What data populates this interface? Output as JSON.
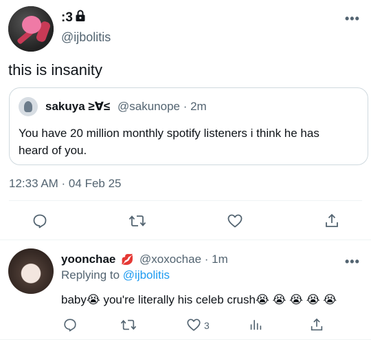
{
  "main_tweet": {
    "display_name": ":3",
    "lock_icon": "lock-icon",
    "handle": "@ijbolitis",
    "more_label": "•••",
    "text": "this is insanity",
    "timestamp": "12:33 AM · 04 Feb 25"
  },
  "quoted_tweet": {
    "display_name": "sakuya ≥∀≤",
    "meta": "@sakunope · 2m",
    "text": "You have 20 million monthly spotify listeners i think he has heard of you."
  },
  "actions": [
    "reply-icon",
    "retweet-icon",
    "like-icon",
    "share-icon"
  ],
  "reply_tweet": {
    "display_name": "yoonchae",
    "badge": "💋",
    "meta": "@xoxochae · 1m",
    "replying_prefix": "Replying to ",
    "replying_handle": "@ijbolitis",
    "more_label": "•••",
    "text": "baby😭 you're literally his celeb crush😭 😭 😭 😭 😭",
    "like_count": "3"
  },
  "colors": {
    "text": "#0f1419",
    "secondary": "#536471",
    "link": "#1d9bf0",
    "border": "#cfd9de"
  }
}
